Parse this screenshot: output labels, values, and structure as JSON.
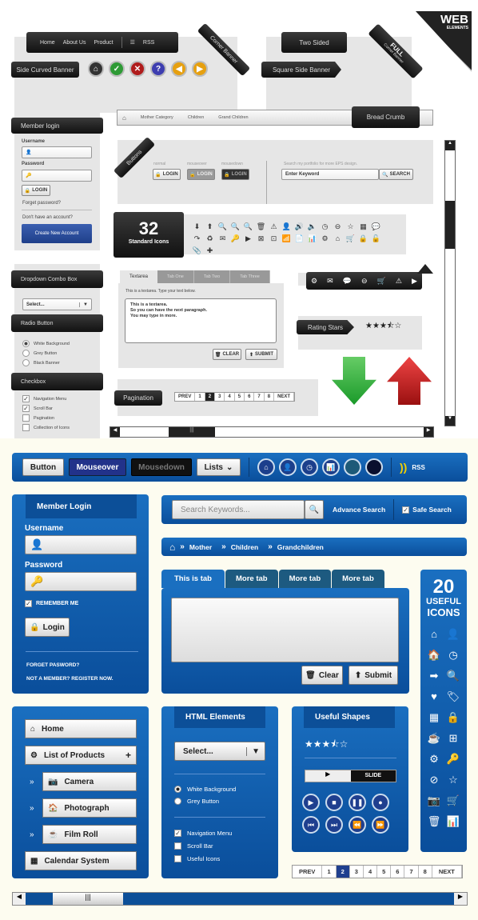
{
  "top": {
    "nav": [
      "Home",
      "About Us",
      "Product",
      "RSS"
    ],
    "corner_banner": "Corner Banner",
    "side_curved_banner": "Side Curved Banner",
    "circle_buttons": [
      {
        "icon": "home-icon",
        "glyph": "⌂",
        "color": "#333333"
      },
      {
        "icon": "check-icon",
        "glyph": "✓",
        "color": "#2e9a35"
      },
      {
        "icon": "close-icon",
        "glyph": "✕",
        "color": "#b01c1c"
      },
      {
        "icon": "help-icon",
        "glyph": "?",
        "color": "#3e3eb0"
      },
      {
        "icon": "arrow-left-icon",
        "glyph": "◀",
        "color": "#e6a010"
      },
      {
        "icon": "arrow-right-icon",
        "glyph": "▶",
        "color": "#e6a010"
      }
    ],
    "two_sided": "Two Sided",
    "square_side_banner": "Square Side Banner",
    "full_corner": "FULL",
    "full_corner_sub": "Corner Banner",
    "web_elements": "WEB",
    "web_elements_sub": "ELEMENTS",
    "login": {
      "title": "Member login",
      "username": "Username",
      "password": "Password",
      "button": "LOGIN",
      "forgot": "Forget password?",
      "no_account": "Don't have an account?",
      "create": "Create New Account"
    },
    "breadcrumb": {
      "items": [
        "Mother Category",
        "Children",
        "Grand Children"
      ],
      "label": "Bread Crumb"
    },
    "buttons": {
      "ribbon": "Buttons",
      "states": [
        "normal",
        "mouseover",
        "mousedown"
      ],
      "login": "LOGIN",
      "search_hint": "Search my portfolio for more EPS design.",
      "search_value": "Enter Keyword",
      "search_btn": "SEARCH"
    },
    "icons_count": "32",
    "icons_label": "Standard Icons",
    "icons": [
      "⬇",
      "⬆",
      "🔍",
      "🔍",
      "🔍",
      "🗑",
      "⚠",
      "👤",
      "🔊",
      "🔈",
      "◷",
      "⊖",
      "☆",
      "▦",
      "💬",
      "↷",
      "♻",
      "✉",
      "🔑",
      "▶",
      "⊠",
      "⊡",
      "📶",
      "📄",
      "📊",
      "⚙",
      "⌂",
      "🛒",
      "🔒",
      "🔓",
      "📎",
      "✚"
    ],
    "dropdown": {
      "title": "Dropdown Combo Box",
      "value": "Select..."
    },
    "radio": {
      "title": "Radio Button",
      "options": [
        "White Background",
        "Grey Button",
        "Black Banner"
      ],
      "selected": 0
    },
    "checkbox": {
      "title": "Checkbox",
      "options": [
        {
          "label": "Navigation Menu",
          "checked": true
        },
        {
          "label": "Scroll Bar",
          "checked": true
        },
        {
          "label": "Pagination",
          "checked": false
        },
        {
          "label": "Collection of Icons",
          "checked": false
        }
      ]
    },
    "textarea": {
      "tabs": [
        "Textarea",
        "Tab One",
        "Tab Two",
        "Tab Three"
      ],
      "hint": "This is a textarea. Type your text below.",
      "lines": [
        "This is a textarea.",
        "So you can have the next paragraph.",
        "You may type in more."
      ],
      "clear": "CLEAR",
      "submit": "SUBMIT"
    },
    "ribbon_icons": [
      "⚙",
      "✉",
      "💬",
      "⊖",
      "🛒",
      "⚠",
      "▶"
    ],
    "rating": {
      "label": "Rating Stars",
      "value": 3.5,
      "max": 5
    },
    "pagination": {
      "label": "Pagination",
      "prev": "PREV",
      "pages": [
        "1",
        "2",
        "3",
        "4",
        "5",
        "6",
        "7",
        "8"
      ],
      "current": "2",
      "next": "NEXT"
    }
  },
  "bottom": {
    "toolbar": {
      "button": "Button",
      "mouseover": "Mouseover",
      "mousedown": "Mousedown",
      "lists": "Lists",
      "rss": "RSS",
      "circles": [
        "⌂",
        "👤",
        "◷",
        "📊",
        "",
        ""
      ],
      "circle_colors": [
        "#1c3f8c",
        "#1c3f8c",
        "#1c3f8c",
        "#1c3f8c",
        "#1d5a78",
        "#0a0f2e"
      ]
    },
    "login": {
      "title": "Member Login",
      "username": "Username",
      "password": "Password",
      "remember": "REMEMBER ME",
      "button": "Login",
      "forgot": "FORGET PASWORD?",
      "register": "NOT A MEMBER? REGISTER NOW."
    },
    "search": {
      "placeholder": "Search Keywords...",
      "advance": "Advance Search",
      "safe": "Safe Search"
    },
    "breadcrumb": [
      "Mother",
      "Children",
      "Grandchildren"
    ],
    "tabs": {
      "items": [
        "This is tab",
        "More tab",
        "More tab",
        "More tab"
      ],
      "clear": "Clear",
      "submit": "Submit"
    },
    "icons_count": "20",
    "icons_label1": "USEFUL",
    "icons_label2": "ICONS",
    "icons": [
      "⌂",
      "👤",
      "🏠",
      "◷",
      "➡",
      "🔍",
      "♥",
      "🏷",
      "▦",
      "🔒",
      "☕",
      "⊞",
      "⚙",
      "🔑",
      "⊘",
      "☆",
      "📷",
      "🛒",
      "🗑",
      "📊"
    ],
    "nav": {
      "items": [
        {
          "label": "Home",
          "icon": "⌂"
        },
        {
          "label": "List of Products",
          "icon": "⚙",
          "extra": "+"
        },
        {
          "label": "Camera",
          "icon": "📷",
          "sub": true
        },
        {
          "label": "Photograph",
          "icon": "🏠",
          "sub": true
        },
        {
          "label": "Film Roll",
          "icon": "☕",
          "sub": true
        },
        {
          "label": "Calendar System",
          "icon": "▦"
        }
      ]
    },
    "html": {
      "title": "HTML Elements",
      "select": "Select...",
      "radios": [
        "White Background",
        "Grey Button"
      ],
      "checks": [
        {
          "label": "Navigation Menu",
          "checked": true
        },
        {
          "label": "Scroll Bar",
          "checked": false
        },
        {
          "label": "Useful Icons",
          "checked": false
        }
      ]
    },
    "shapes": {
      "title": "Useful Shapes",
      "rating": 3.5,
      "slide": "SLIDE",
      "media": [
        "▶",
        "■",
        "❚❚",
        "●",
        "⏮",
        "⏭",
        "⏪",
        "⏩"
      ]
    },
    "pagination": {
      "prev": "PREV",
      "pages": [
        "1",
        "2",
        "3",
        "4",
        "5",
        "6",
        "7",
        "8"
      ],
      "current": "2",
      "next": "NEXT"
    }
  }
}
